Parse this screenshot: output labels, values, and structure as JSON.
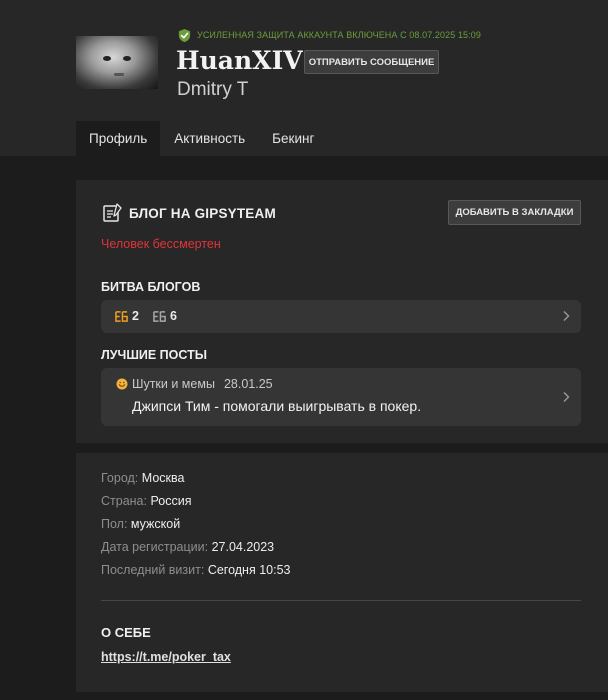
{
  "profile": {
    "security_text": "Усиленная защита аккаунта включена с 08.07.2025 15:09",
    "username": "HuanXIV",
    "real_name": "Dmitry T",
    "send_message_label": "Отправить сообщение",
    "security_color": "#6b9e3a"
  },
  "tabs": [
    {
      "label": "Профиль",
      "active": true
    },
    {
      "label": "Активность",
      "active": false
    },
    {
      "label": "Бекинг",
      "active": false
    }
  ],
  "blog": {
    "title": "Блог на GipsyTeam",
    "bookmark_label": "Добавить в закладки",
    "tagline": "Человек бессмертен",
    "tagline_color": "#e0343a",
    "battle_title": "Битва блогов",
    "battle_items": [
      {
        "icon": "battle-of-blogs-gold-icon",
        "value": "2"
      },
      {
        "icon": "battle-of-blogs-silver-icon",
        "value": "6"
      }
    ],
    "best_posts_title": "Лучшие посты",
    "best_post": {
      "category_icon": "smiley-emoji-icon",
      "category": "Шутки и мемы",
      "date": "28.01.25",
      "title": "Джипси Тим - помогали выигрывать в покер."
    }
  },
  "info": {
    "rows": [
      {
        "label": "Город:",
        "value": "Москва"
      },
      {
        "label": "Страна:",
        "value": "Россия"
      },
      {
        "label": "Пол:",
        "value": "мужской"
      },
      {
        "label": "Дата регистрации:",
        "value": "27.04.2023"
      },
      {
        "label": "Последний визит:",
        "value": "Сегодня 10:53"
      }
    ],
    "about_title": "О себе",
    "about_link": "https://t.me/poker_tax"
  }
}
